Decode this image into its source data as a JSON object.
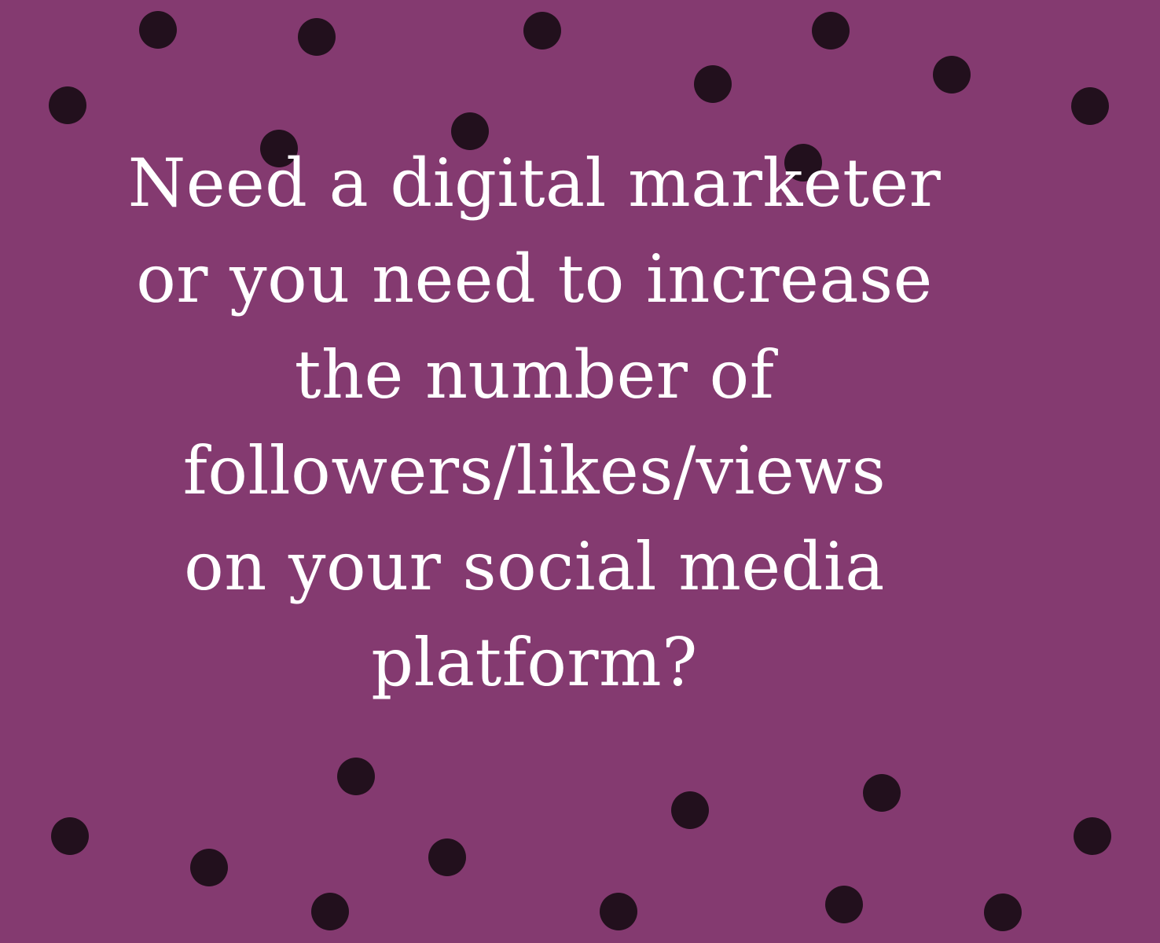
{
  "colors": {
    "background": "#843a70",
    "dot": "#22101d",
    "text": "#ffffff"
  },
  "headline": {
    "lines": [
      "Need a digital marketer",
      "or you need to increase",
      "the number of",
      "followers/likes/views",
      "on your social media",
      "platform?"
    ]
  }
}
